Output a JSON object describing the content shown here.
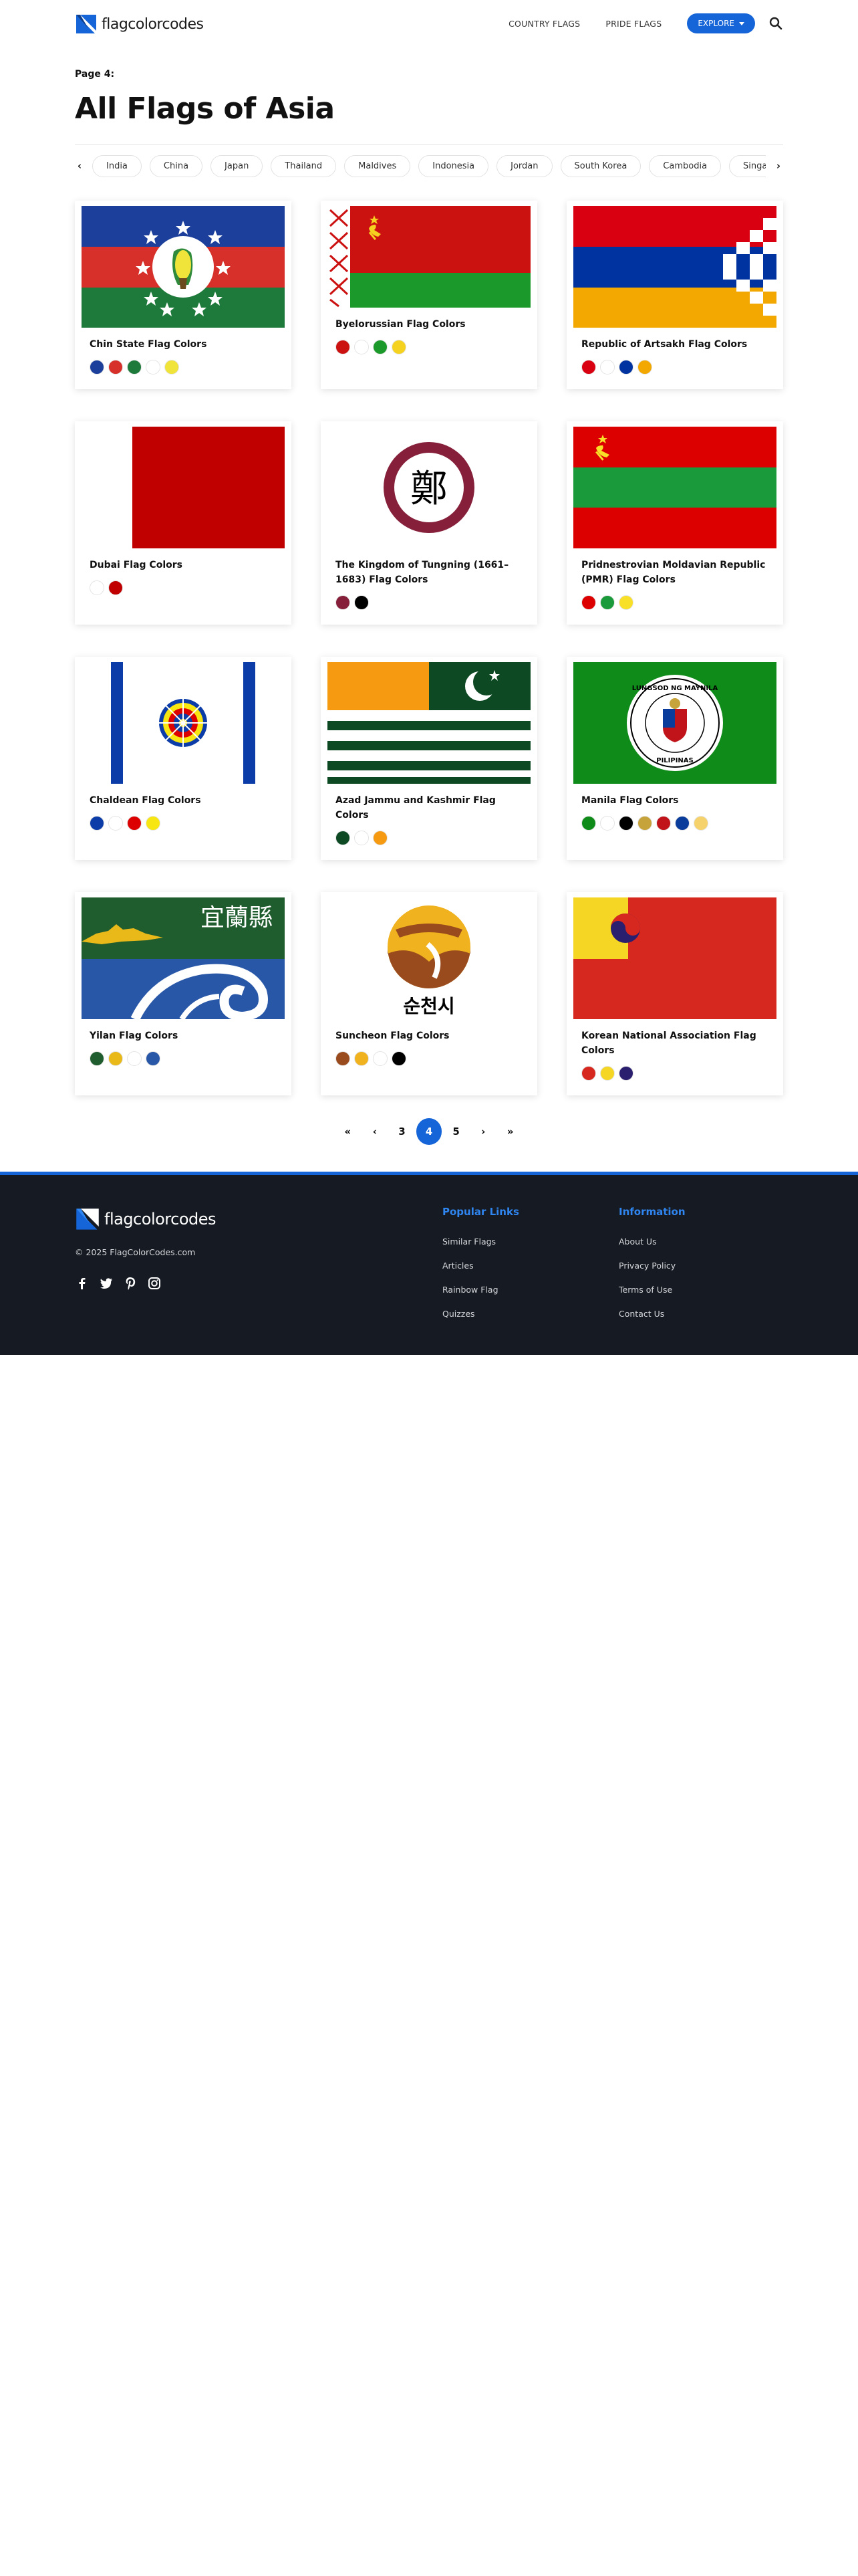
{
  "header": {
    "logo_text": "flagcolorcodes",
    "nav": {
      "country_flags": "COUNTRY FLAGS",
      "pride_flags": "PRIDE FLAGS",
      "explore": "EXPLORE"
    }
  },
  "page": {
    "label": "Page 4:",
    "title": "All Flags of Asia"
  },
  "countries": [
    "India",
    "China",
    "Japan",
    "Thailand",
    "Maldives",
    "Indonesia",
    "Jordan",
    "South Korea",
    "Cambodia",
    "Singapore"
  ],
  "flags": [
    {
      "title": "Chin State Flag Colors",
      "colors": [
        "#1c3f9c",
        "#d7302a",
        "#1e7a3a",
        "#ffffff",
        "#f0e33a"
      ]
    },
    {
      "title": "Byelorussian Flag Colors",
      "colors": [
        "#cc1111",
        "#ffffff",
        "#1b9a2b",
        "#f5d21f"
      ]
    },
    {
      "title": "Republic of Artsakh Flag Colors",
      "colors": [
        "#d90012",
        "#ffffff",
        "#0033a0",
        "#f2a800"
      ]
    },
    {
      "title": "Dubai Flag Colors",
      "colors": [
        "#ffffff",
        "#c00000"
      ]
    },
    {
      "title": "The Kingdom of Tungning (1661–1683) Flag Colors",
      "colors": [
        "#861f3a",
        "#000000"
      ]
    },
    {
      "title": "Pridnestrovian Moldavian Republic (PMR) Flag Colors",
      "colors": [
        "#dd0000",
        "#1b9a3b",
        "#f8e028"
      ]
    },
    {
      "title": "Chaldean Flag Colors",
      "colors": [
        "#0b3ca8",
        "#ffffff",
        "#dd0000",
        "#f8e612"
      ]
    },
    {
      "title": "Azad Jammu and Kashmir Flag Colors",
      "colors": [
        "#0d4a24",
        "#ffffff",
        "#f59a11"
      ]
    },
    {
      "title": "Manila Flag Colors",
      "colors": [
        "#0f8b1a",
        "#ffffff",
        "#000000",
        "#c7a33b",
        "#c0141a",
        "#0a3c9c",
        "#f5d26b"
      ]
    },
    {
      "title": "Yilan Flag Colors",
      "colors": [
        "#1f5c2e",
        "#e8b918",
        "#ffffff",
        "#2857a8"
      ]
    },
    {
      "title": "Suncheon Flag Colors",
      "colors": [
        "#9a4b1d",
        "#f0b21e",
        "#ffffff",
        "#000000"
      ]
    },
    {
      "title": "Korean National Association Flag Colors",
      "colors": [
        "#d7281f",
        "#f5d625",
        "#2a1e6e"
      ]
    }
  ],
  "flag_art_text": {
    "tungning_char": "鄭",
    "yilan_chars": "宜蘭縣",
    "suncheon_chars": "순천시",
    "manila_seal_top": "LUNGSOD NG MAYNILA",
    "manila_seal_bottom": "PILIPINAS"
  },
  "pagination": {
    "first": "«",
    "prev": "‹",
    "pages": [
      "3",
      "4",
      "5"
    ],
    "current": "4",
    "next": "›",
    "last": "»"
  },
  "footer": {
    "logo_text": "flagcolorcodes",
    "copyright": "© 2025 FlagColorCodes.com",
    "popular_title": "Popular Links",
    "popular_links": [
      "Similar Flags",
      "Articles",
      "Rainbow Flag",
      "Quizzes"
    ],
    "info_title": "Information",
    "info_links": [
      "About Us",
      "Privacy Policy",
      "Terms of Use",
      "Contact Us"
    ],
    "social_icons": [
      "facebook-icon",
      "twitter-icon",
      "pinterest-icon",
      "instagram-icon"
    ]
  },
  "colors": {
    "accent": "#1565d8",
    "footer_bg": "#161a22",
    "footer_heading": "#2f86f0"
  }
}
